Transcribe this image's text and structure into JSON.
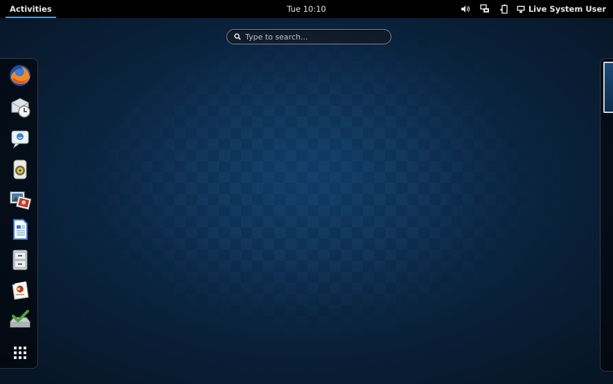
{
  "topbar": {
    "activities_label": "Activities",
    "clock": "Tue 10:10",
    "tray_icons": [
      "volume-icon",
      "network-icon",
      "battery-icon"
    ],
    "user_name": "Live System User"
  },
  "search": {
    "placeholder": "Type to search..."
  },
  "dash": {
    "apps": [
      "firefox-icon",
      "evolution-icon",
      "empathy-icon",
      "rhythmbox-icon",
      "shotwell-icon",
      "libreoffice-writer-icon",
      "files-icon",
      "software-icon",
      "install-to-hard-drive-icon"
    ],
    "show_apps": "show-applications-icon"
  },
  "colors": {
    "accent": "#5b9bd5",
    "background": "#0a2440",
    "topbar": "#000000"
  }
}
